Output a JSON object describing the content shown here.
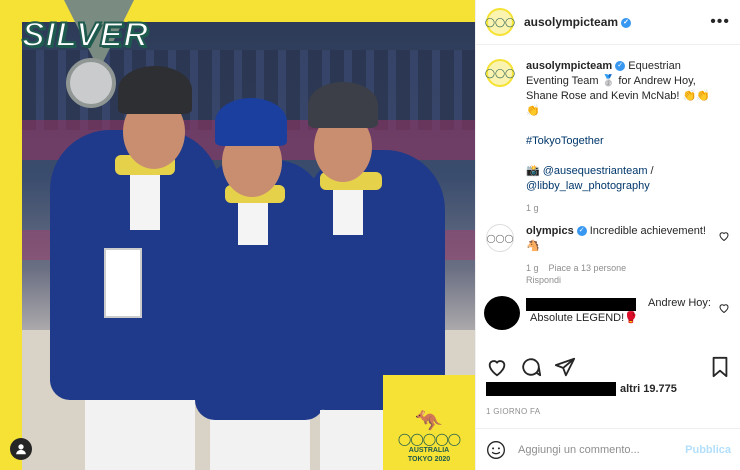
{
  "photo": {
    "medal_text": "SILVER",
    "brand_line1": "AUSTRALIA",
    "brand_line2": "TOKYO 2020"
  },
  "header": {
    "username": "ausolympicteam",
    "more_label": "•••"
  },
  "caption": {
    "username": "ausolympicteam",
    "text": "Equestrian Eventing Team 🥈 for Andrew Hoy, Shane Rose and Kevin McNab! 👏👏👏",
    "hashtag": "#TokyoTogether",
    "credits_prefix": "📸 ",
    "credit1": "@ausequestrianteam",
    "credit_sep": " / ",
    "credit2": "@libby_law_photography",
    "time": "1 g"
  },
  "comments": [
    {
      "username": "olympics",
      "text": "Incredible achievement! 🐴",
      "time": "1 g",
      "likes": "Piace a 13 persone",
      "reply": "Rispondi"
    },
    {
      "username": "",
      "text_prefix": "Andrew Hoy:",
      "text": "Absolute LEGEND!🥊"
    }
  ],
  "likes": {
    "text": "altri 19.775"
  },
  "date": "1 GIORNO FA",
  "add_comment": {
    "placeholder": "Aggiungi un commento...",
    "publish": "Pubblica"
  },
  "colors": {
    "brand_yellow": "#f5e234",
    "brand_green": "#1f5a4f",
    "jacket_blue": "#1f3a8a",
    "link_blue": "#00376b",
    "verified_blue": "#3897f0"
  }
}
